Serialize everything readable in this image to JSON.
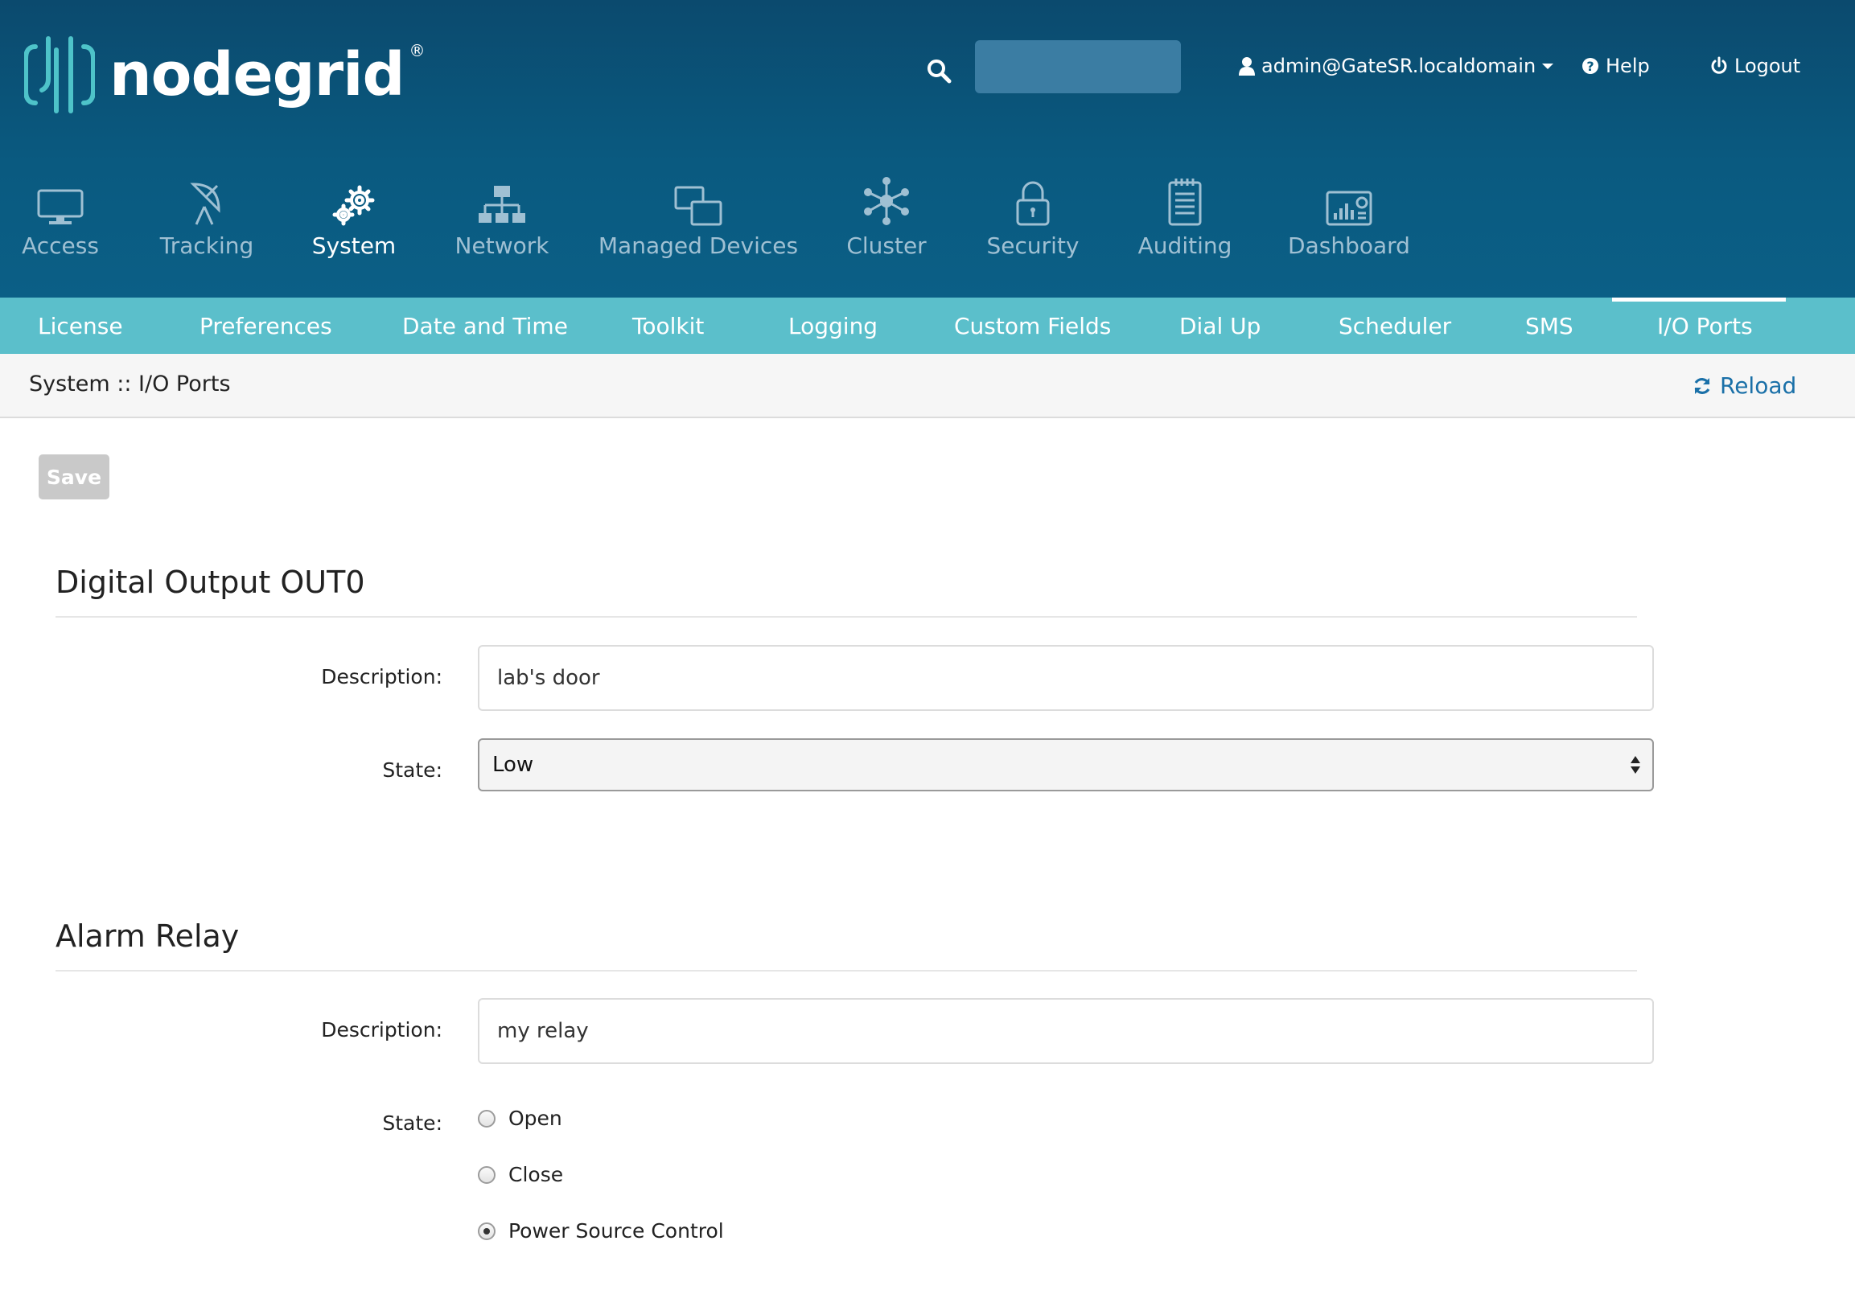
{
  "brand": {
    "name": "nodegrid",
    "reg": "®"
  },
  "header": {
    "user": "admin@GateSR.localdomain",
    "help": "Help",
    "logout": "Logout"
  },
  "main_nav": [
    {
      "label": "Access",
      "icon": "monitor-icon",
      "active": false
    },
    {
      "label": "Tracking",
      "icon": "satellite-dish-icon",
      "active": false
    },
    {
      "label": "System",
      "icon": "gear-icon",
      "active": true
    },
    {
      "label": "Network",
      "icon": "network-tree-icon",
      "active": false
    },
    {
      "label": "Managed Devices",
      "icon": "windows-icon",
      "active": false
    },
    {
      "label": "Cluster",
      "icon": "cluster-icon",
      "active": false
    },
    {
      "label": "Security",
      "icon": "lock-icon",
      "active": false
    },
    {
      "label": "Auditing",
      "icon": "notepad-icon",
      "active": false
    },
    {
      "label": "Dashboard",
      "icon": "dashboard-icon",
      "active": false
    }
  ],
  "sub_nav": [
    {
      "label": "License"
    },
    {
      "label": "Preferences"
    },
    {
      "label": "Date and Time"
    },
    {
      "label": "Toolkit"
    },
    {
      "label": "Logging"
    },
    {
      "label": "Custom Fields"
    },
    {
      "label": "Dial Up"
    },
    {
      "label": "Scheduler"
    },
    {
      "label": "SMS"
    },
    {
      "label": "I/O Ports",
      "active": true
    }
  ],
  "breadcrumb": "System :: I/O Ports",
  "reload_label": "Reload",
  "save_label": "Save",
  "digital_output": {
    "title": "Digital Output OUT0",
    "description_label": "Description:",
    "description_value": "lab's door",
    "state_label": "State:",
    "state_value": "Low"
  },
  "alarm_relay": {
    "title": "Alarm Relay",
    "description_label": "Description:",
    "description_value": "my relay",
    "state_label": "State:",
    "options": [
      {
        "label": "Open",
        "checked": false
      },
      {
        "label": "Close",
        "checked": false
      },
      {
        "label": "Power Source Control",
        "checked": true
      }
    ]
  },
  "colors": {
    "header_bg": "#0b5a80",
    "subnav_bg": "#5bbfcb",
    "link": "#1a70a8",
    "logo_accent": "#4ec3c9"
  }
}
